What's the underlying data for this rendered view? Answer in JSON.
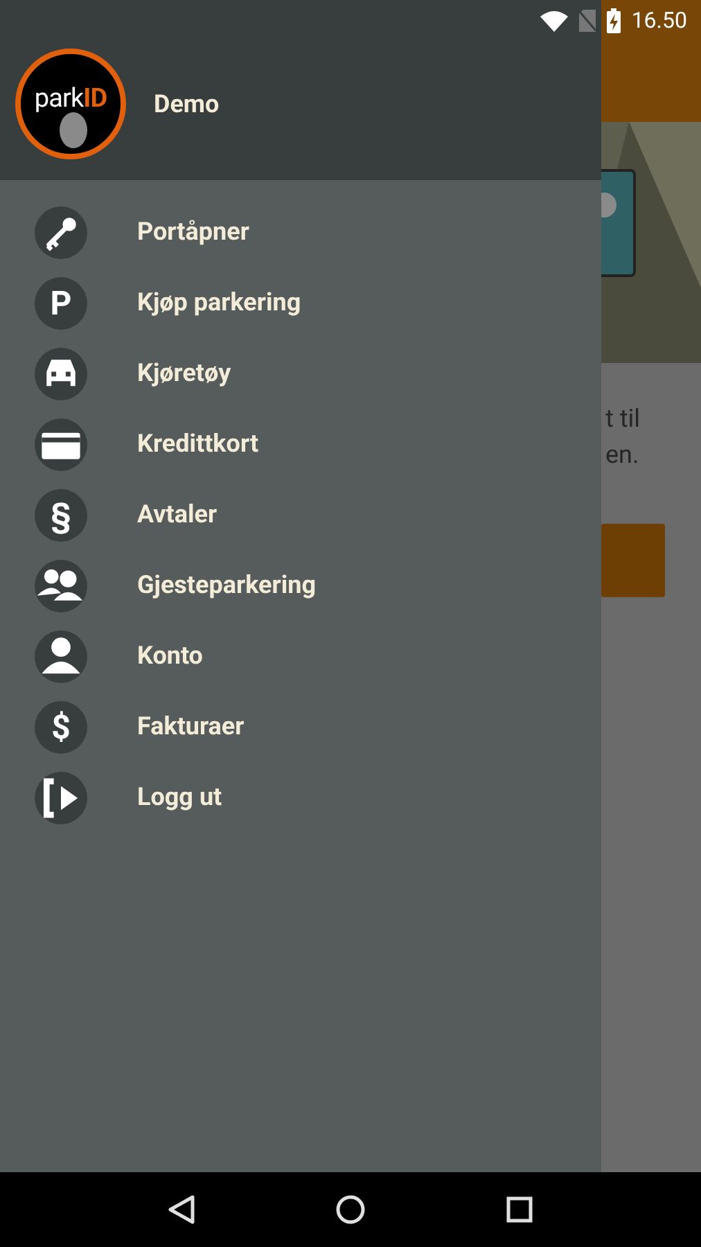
{
  "status_bar": {
    "time": "16.50"
  },
  "drawer": {
    "logo": {
      "text_1": "park",
      "text_2": "ID"
    },
    "user_name": "Demo",
    "items": [
      {
        "kind": "key",
        "label": "Portåpner"
      },
      {
        "kind": "glyph",
        "glyph": "P",
        "label": "Kjøp parkering"
      },
      {
        "kind": "car",
        "label": "Kjøretøy"
      },
      {
        "kind": "card",
        "label": "Kredittkort"
      },
      {
        "kind": "glyph",
        "glyph": "§",
        "label": "Avtaler"
      },
      {
        "kind": "group",
        "label": "Gjesteparkering"
      },
      {
        "kind": "person",
        "label": "Konto"
      },
      {
        "kind": "glyph",
        "glyph": "$",
        "label": "Fakturaer"
      },
      {
        "kind": "logout",
        "label": "Logg ut"
      }
    ]
  },
  "background_screen": {
    "text_lines": [
      "t til",
      "en."
    ]
  }
}
